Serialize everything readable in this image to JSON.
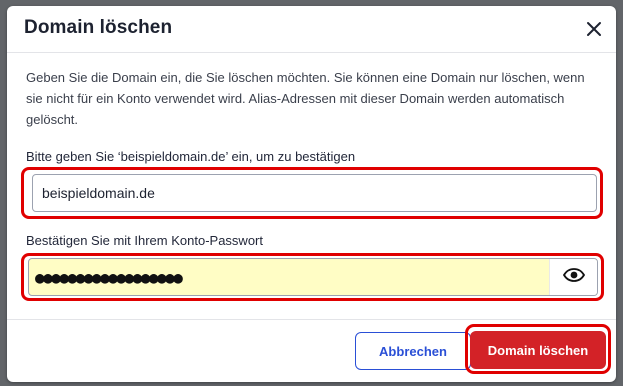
{
  "dialog": {
    "title": "Domain löschen",
    "close_icon": "close-icon",
    "description": "Geben Sie die Domain ein, die Sie löschen möchten. Sie können eine Domain nur löschen, wenn sie nicht für ein Konto verwendet wird. Alias-Adressen mit dieser Domain werden automatisch gelöscht."
  },
  "confirm_field": {
    "label": "Bitte geben Sie ‘beispieldomain.de’ ein, um zu bestätigen",
    "value": "beispieldomain.de"
  },
  "password_field": {
    "label": "Bestätigen Sie mit Ihrem Konto-Passwort",
    "value": "●●●●●●●●●●●●●●●●●●",
    "toggle_icon": "eye-icon"
  },
  "actions": {
    "cancel_label": "Abbrechen",
    "delete_label": "Domain löschen"
  },
  "colors": {
    "highlight": "#e00000",
    "danger": "#d32227",
    "accent": "#2a4fd6",
    "autofill": "#fffdc5"
  }
}
